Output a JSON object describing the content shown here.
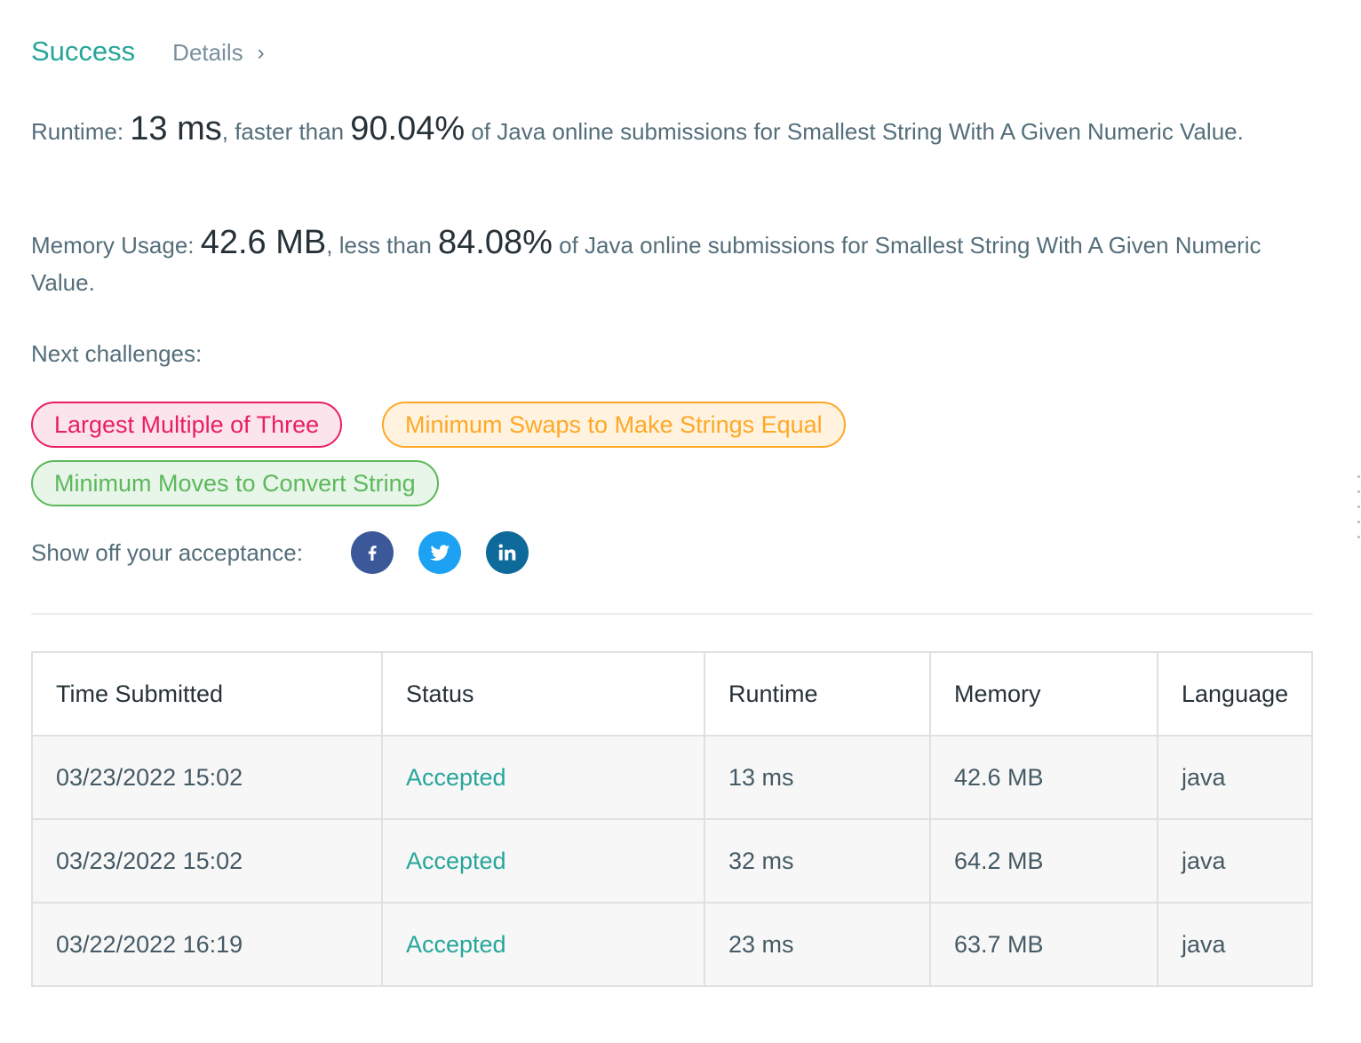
{
  "header": {
    "status": "Success",
    "details_label": "Details"
  },
  "runtime": {
    "label": "Runtime: ",
    "value": "13 ms",
    "mid": ", faster than ",
    "percent": "90.04%",
    "tail": " of Java online submissions for Smallest String With A Given Numeric Value."
  },
  "memory": {
    "label": "Memory Usage: ",
    "value": "42.6 MB",
    "mid": ", less than ",
    "percent": "84.08%",
    "tail": " of Java online submissions for Smallest String With A Given Numeric Value."
  },
  "next": {
    "label": "Next challenges:",
    "challenges": [
      {
        "title": "Largest Multiple of Three",
        "difficulty_color": "#e91e63"
      },
      {
        "title": "Minimum Swaps to Make Strings Equal",
        "difficulty_color": "#ffa726"
      },
      {
        "title": "Minimum Moves to Convert String",
        "difficulty_color": "#5cb85c"
      }
    ]
  },
  "share": {
    "label": "Show off your acceptance:",
    "icons": [
      "facebook-icon",
      "twitter-icon",
      "linkedin-icon"
    ]
  },
  "table": {
    "headers": [
      "Time Submitted",
      "Status",
      "Runtime",
      "Memory",
      "Language"
    ],
    "rows": [
      {
        "time": "03/23/2022 15:02",
        "status": "Accepted",
        "runtime": "13 ms",
        "memory": "42.6 MB",
        "language": "java"
      },
      {
        "time": "03/23/2022 15:02",
        "status": "Accepted",
        "runtime": "32 ms",
        "memory": "64.2 MB",
        "language": "java"
      },
      {
        "time": "03/22/2022 16:19",
        "status": "Accepted",
        "runtime": "23 ms",
        "memory": "63.7 MB",
        "language": "java"
      }
    ]
  },
  "colors": {
    "success": "#26a69a",
    "accepted": "#26a69a",
    "facebook": "#3b5998",
    "twitter": "#1da1f2",
    "linkedin": "#0e6a9a"
  }
}
